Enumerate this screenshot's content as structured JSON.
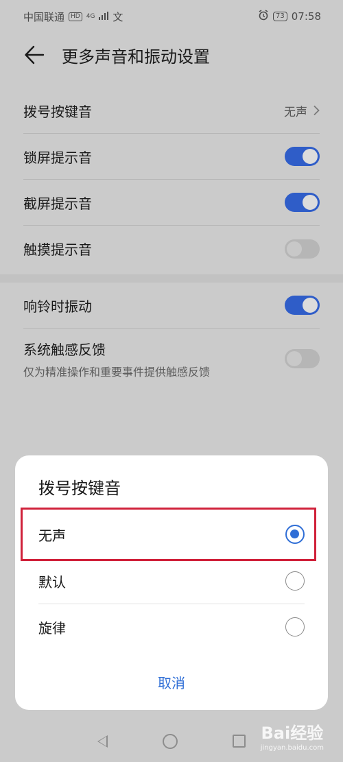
{
  "status_bar": {
    "carrier": "中国联通",
    "network_badge": "HD",
    "signal_text": "4G",
    "extra_icon_text": "文",
    "battery": "73",
    "time": "07:58"
  },
  "header": {
    "back_icon": "back-arrow-icon",
    "title": "更多声音和振动设置"
  },
  "settings": {
    "group1": [
      {
        "label": "拨号按键音",
        "value": "无声",
        "type": "select"
      },
      {
        "label": "锁屏提示音",
        "type": "toggle",
        "on": true
      },
      {
        "label": "截屏提示音",
        "type": "toggle",
        "on": true
      },
      {
        "label": "触摸提示音",
        "type": "toggle",
        "on": false
      }
    ],
    "group2": [
      {
        "label": "响铃时振动",
        "type": "toggle",
        "on": true
      },
      {
        "label": "系统触感反馈",
        "sublabel": "仅为精准操作和重要事件提供触感反馈",
        "type": "toggle",
        "on": false
      }
    ]
  },
  "dialog": {
    "title": "拨号按键音",
    "options": [
      {
        "label": "无声",
        "selected": true
      },
      {
        "label": "默认",
        "selected": false
      },
      {
        "label": "旋律",
        "selected": false
      }
    ],
    "cancel_label": "取消"
  },
  "navigation": {
    "back_icon": "nav-back-icon",
    "home_icon": "nav-home-icon",
    "recent_icon": "nav-recent-icon"
  },
  "watermark": {
    "text": "Bai经验",
    "sub": "jingyan.baidu.com"
  },
  "colors": {
    "accent": "#2f6ed6",
    "toggle_on": "#2f5dc8",
    "highlight_border": "#d0213a",
    "overlay_bg": "#cbcbcb"
  }
}
